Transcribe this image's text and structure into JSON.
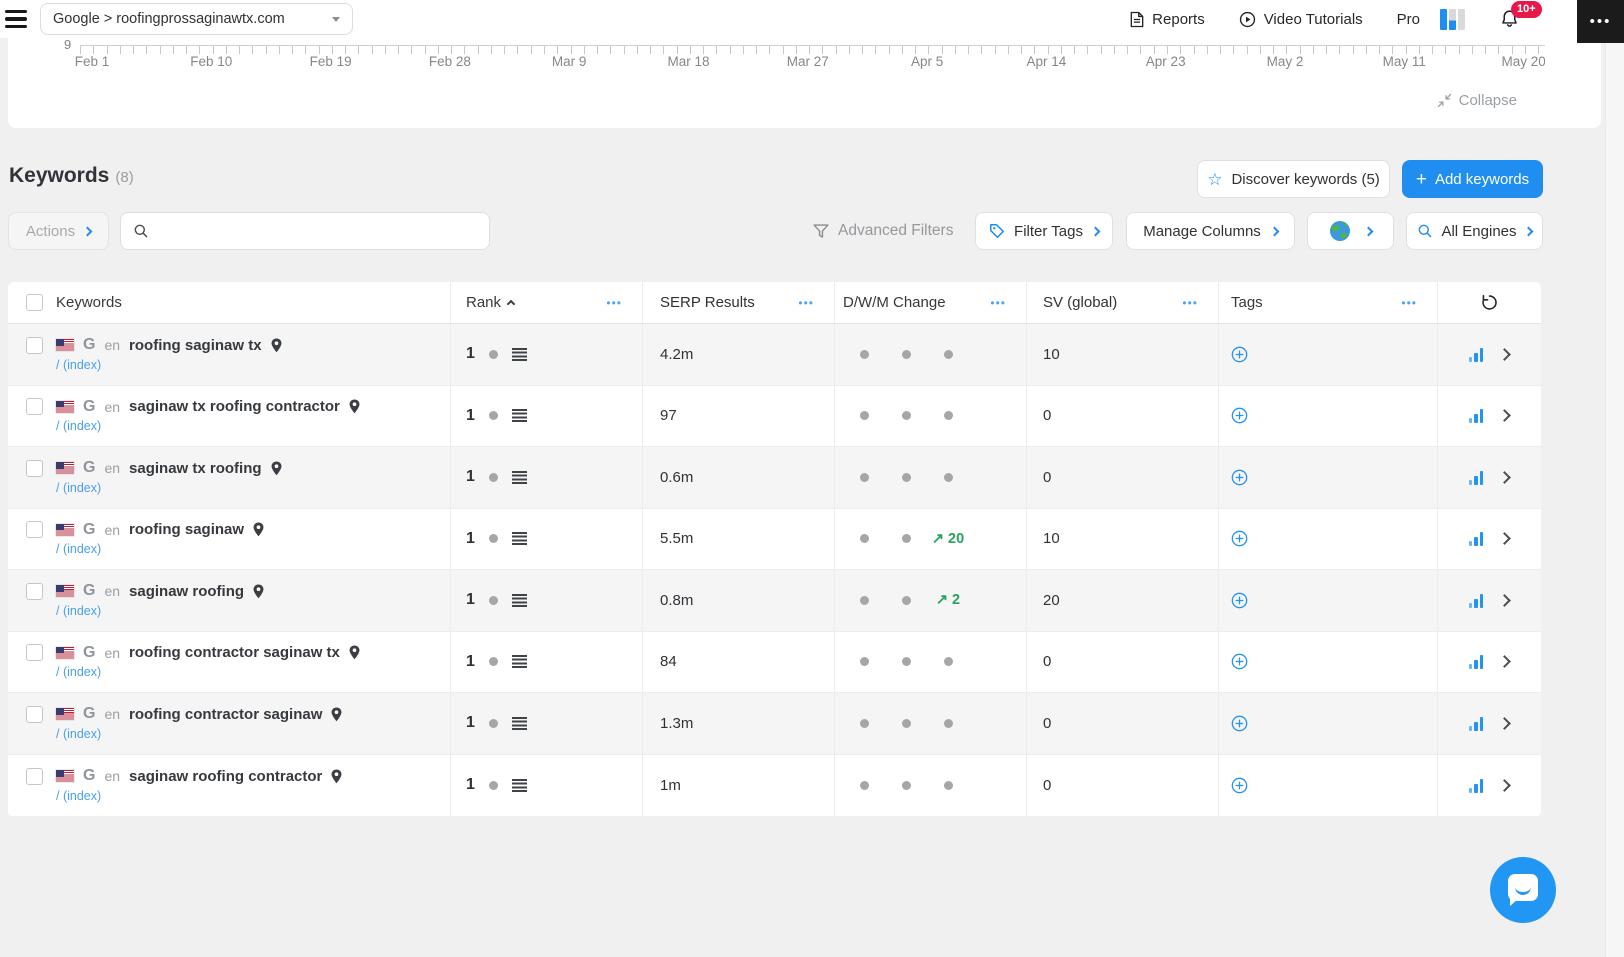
{
  "topbar": {
    "project_selector_label": "Google > roofingprossaginawtx.com",
    "reports_label": "Reports",
    "video_tutorials_label": "Video Tutorials",
    "plan_label": "Pro",
    "notification_badge": "10+",
    "more_icon": "•••"
  },
  "chart_panel": {
    "y_tick_label": "9",
    "date_ticks": [
      "Feb 1",
      "Feb 10",
      "Feb 19",
      "Feb 28",
      "Mar 9",
      "Mar 18",
      "Mar 27",
      "Apr 5",
      "Apr 14",
      "Apr 23",
      "May 2",
      "May 11",
      "May 20"
    ],
    "collapse_label": "Collapse"
  },
  "keywords_header": {
    "title": "Keywords",
    "count": "(8)",
    "discover_button_label": "Discover keywords (5)",
    "add_button_label": "Add keywords",
    "plus_icon": "+",
    "star_icon": "☆"
  },
  "toolbar": {
    "actions_label": "Actions",
    "search_placeholder": "",
    "advanced_filters_label": "Advanced Filters",
    "filter_tags_label": "Filter Tags",
    "manage_columns_label": "Manage Columns",
    "all_engines_label": "All Engines"
  },
  "table": {
    "column_menu_icon": "•••",
    "columns": [
      "Keywords",
      "Rank",
      "SERP Results",
      "D/W/M Change",
      "SV (global)",
      "Tags"
    ],
    "sort": {
      "column": "Rank",
      "direction": "asc"
    },
    "rows": [
      {
        "flag": "us",
        "engine": "G",
        "lang": "en",
        "keyword": "roofing saginaw tx",
        "url": "/ (index)",
        "rank": "1",
        "serp_results": "4.2m",
        "dwm_change": [
          null,
          null,
          null
        ],
        "sv_global": "10"
      },
      {
        "flag": "us",
        "engine": "G",
        "lang": "en",
        "keyword": "saginaw tx roofing contractor",
        "url": "/ (index)",
        "rank": "1",
        "serp_results": "97",
        "dwm_change": [
          null,
          null,
          null
        ],
        "sv_global": "0"
      },
      {
        "flag": "us",
        "engine": "G",
        "lang": "en",
        "keyword": "saginaw tx roofing",
        "url": "/ (index)",
        "rank": "1",
        "serp_results": "0.6m",
        "dwm_change": [
          null,
          null,
          null
        ],
        "sv_global": "0"
      },
      {
        "flag": "us",
        "engine": "G",
        "lang": "en",
        "keyword": "roofing saginaw",
        "url": "/ (index)",
        "rank": "1",
        "serp_results": "5.5m",
        "dwm_change": [
          null,
          null,
          "20"
        ],
        "sv_global": "10"
      },
      {
        "flag": "us",
        "engine": "G",
        "lang": "en",
        "keyword": "saginaw roofing",
        "url": "/ (index)",
        "rank": "1",
        "serp_results": "0.8m",
        "dwm_change": [
          null,
          null,
          "2"
        ],
        "sv_global": "20"
      },
      {
        "flag": "us",
        "engine": "G",
        "lang": "en",
        "keyword": "roofing contractor saginaw tx",
        "url": "/ (index)",
        "rank": "1",
        "serp_results": "84",
        "dwm_change": [
          null,
          null,
          null
        ],
        "sv_global": "0"
      },
      {
        "flag": "us",
        "engine": "G",
        "lang": "en",
        "keyword": "roofing contractor saginaw",
        "url": "/ (index)",
        "rank": "1",
        "serp_results": "1.3m",
        "dwm_change": [
          null,
          null,
          null
        ],
        "sv_global": "0"
      },
      {
        "flag": "us",
        "engine": "G",
        "lang": "en",
        "keyword": "saginaw roofing contractor",
        "url": "/ (index)",
        "rank": "1",
        "serp_results": "1m",
        "dwm_change": [
          null,
          null,
          null
        ],
        "sv_global": "0"
      }
    ]
  },
  "colors": {
    "accent": "#1f8ef0",
    "green": "#27a35f",
    "badge_red": "#e8174a"
  },
  "change_arrow_icon": "↗"
}
